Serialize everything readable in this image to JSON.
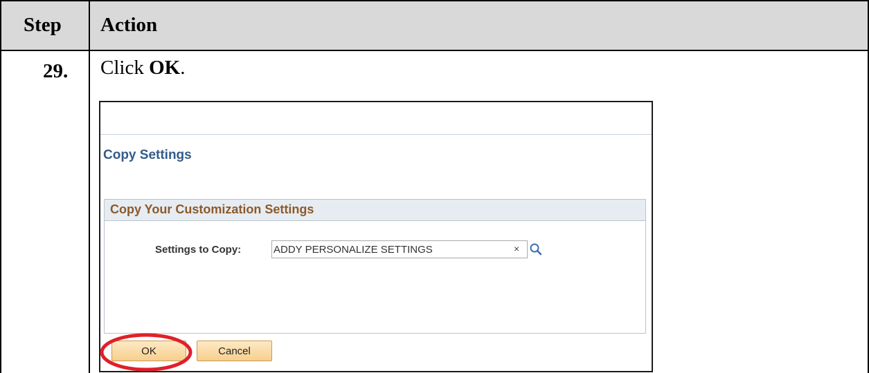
{
  "table": {
    "header_step": "Step",
    "header_action": "Action",
    "step_number": "29.",
    "instruction_prefix": "Click ",
    "instruction_target": "OK",
    "instruction_suffix": "."
  },
  "dialog": {
    "title": "Copy Settings",
    "group_title": "Copy Your Customization Settings",
    "field_label": "Settings to Copy:",
    "field_value": "ADDY PERSONALIZE SETTINGS",
    "clear_glyph": "×",
    "ok_label": "OK",
    "cancel_label": "Cancel"
  },
  "colors": {
    "header_fill": "#d9d9d9",
    "title_text": "#335b8a",
    "group_title_text": "#8c5a2a",
    "button_fill": "#f7cf8e",
    "highlight_ring": "#e0202a"
  },
  "icons": {
    "lookup": "magnifier-icon",
    "clear": "clear-x-icon"
  }
}
